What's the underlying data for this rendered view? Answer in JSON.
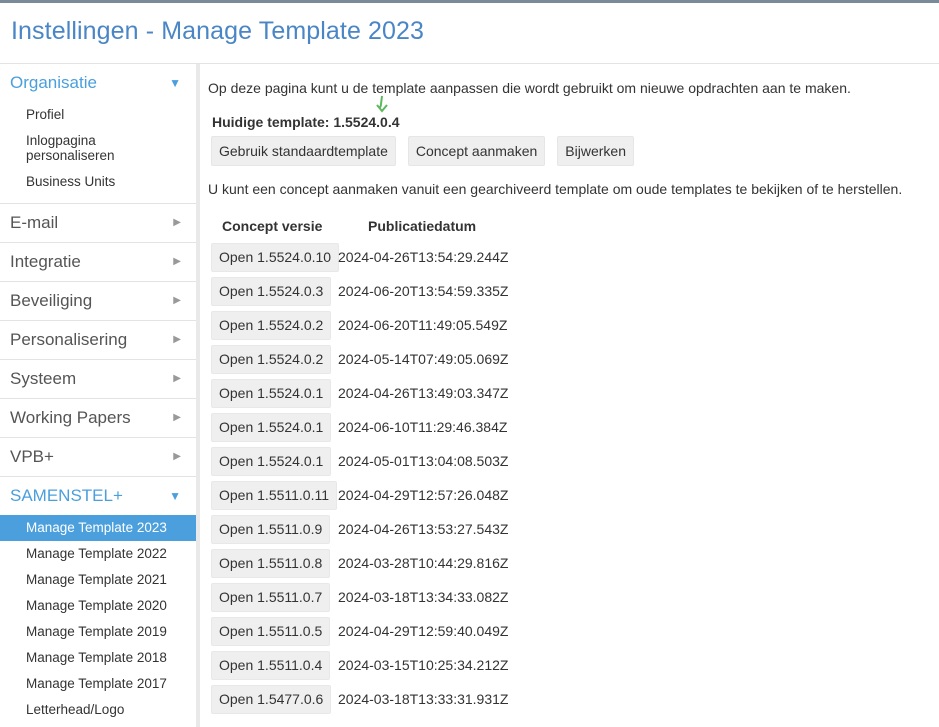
{
  "header": {
    "title": "Instellingen - Manage Template 2023"
  },
  "sidebar": {
    "organisatie": {
      "label": "Organisatie",
      "items": [
        "Profiel",
        "Inlogpagina\npersonaliseren",
        "Business Units"
      ]
    },
    "sections": [
      "E-mail",
      "Integratie",
      "Beveiliging",
      "Personalisering",
      "Systeem",
      "Working Papers",
      "VPB+"
    ],
    "samenstel": {
      "label": "SAMENSTEL+",
      "items": [
        "Manage Template 2023",
        "Manage Template 2022",
        "Manage Template 2021",
        "Manage Template 2020",
        "Manage Template 2019",
        "Manage Template 2018",
        "Manage Template 2017",
        "Letterhead/Logo"
      ],
      "active_index": 0
    }
  },
  "main": {
    "intro": "Op deze pagina kunt u de template aanpassen die wordt gebruikt om nieuwe opdrachten aan te maken.",
    "current_template": "Huidige template: 1.5524.0.4",
    "buttons": {
      "use_default": "Gebruik standaardtemplate",
      "create_concept": "Concept aanmaken",
      "update": "Bijwerken"
    },
    "info": "U kunt een concept aanmaken vanuit een gearchiveerd template om oude templates te bekijken of te herstellen.",
    "table": {
      "headers": [
        "Concept versie",
        "Publicatiedatum"
      ],
      "rows": [
        {
          "version": "Open 1.5524.0.10",
          "date": "2024-04-26T13:54:29.244Z"
        },
        {
          "version": "Open 1.5524.0.3",
          "date": "2024-06-20T13:54:59.335Z"
        },
        {
          "version": "Open 1.5524.0.2",
          "date": "2024-06-20T11:49:05.549Z"
        },
        {
          "version": "Open 1.5524.0.2",
          "date": "2024-05-14T07:49:05.069Z"
        },
        {
          "version": "Open 1.5524.0.1",
          "date": "2024-04-26T13:49:03.347Z"
        },
        {
          "version": "Open 1.5524.0.1",
          "date": "2024-06-10T11:29:46.384Z"
        },
        {
          "version": "Open 1.5524.0.1",
          "date": "2024-05-01T13:04:08.503Z"
        },
        {
          "version": "Open 1.5511.0.11",
          "date": "2024-04-29T12:57:26.048Z"
        },
        {
          "version": "Open 1.5511.0.9",
          "date": "2024-04-26T13:53:27.543Z"
        },
        {
          "version": "Open 1.5511.0.8",
          "date": "2024-03-28T10:44:29.816Z"
        },
        {
          "version": "Open 1.5511.0.7",
          "date": "2024-03-18T13:34:33.082Z"
        },
        {
          "version": "Open 1.5511.0.5",
          "date": "2024-04-29T12:59:40.049Z"
        },
        {
          "version": "Open 1.5511.0.4",
          "date": "2024-03-15T10:25:34.212Z"
        },
        {
          "version": "Open 1.5477.0.6",
          "date": "2024-03-18T13:33:31.931Z"
        }
      ]
    }
  },
  "colors": {
    "accent": "#4a9fdc",
    "title": "#4a86c5",
    "marker": "#5cb85c"
  }
}
